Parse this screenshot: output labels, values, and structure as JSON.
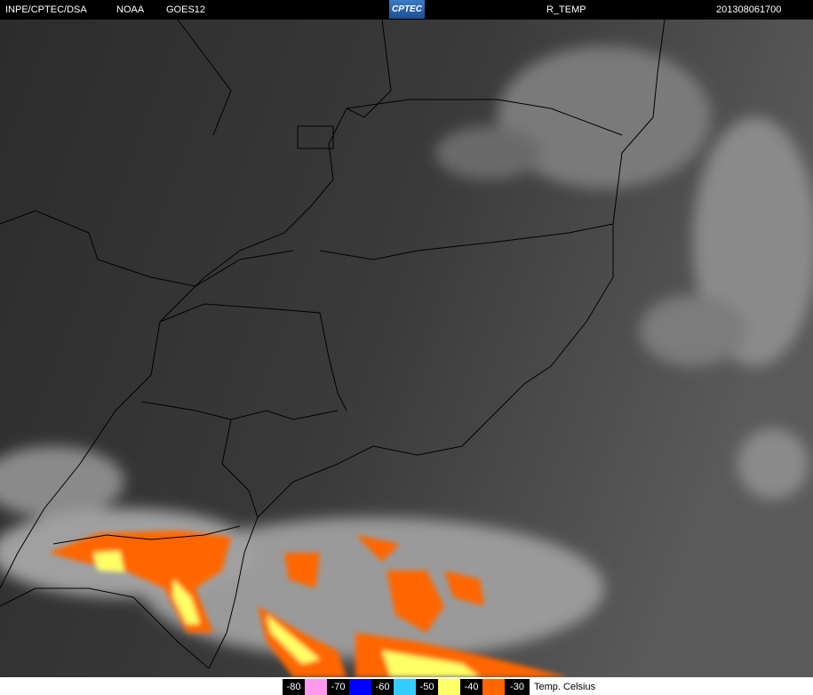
{
  "header": {
    "source": "INPE/CPTEC/DSA",
    "agency": "NOAA",
    "satellite": "GOES12",
    "logo": "CPTEC",
    "product": "R_TEMP",
    "timestamp": "201308061700"
  },
  "legend": {
    "items": [
      {
        "label": "-80",
        "color": "#ff99ee"
      },
      {
        "label": "-70",
        "color": "#0000ff"
      },
      {
        "label": "-60",
        "color": "#33ccff"
      },
      {
        "label": "-50",
        "color": "#ffff66"
      },
      {
        "label": "-40",
        "color": "#ff6600"
      },
      {
        "label": "-30",
        "color": null
      }
    ],
    "unit": "Temp. Celsius"
  }
}
